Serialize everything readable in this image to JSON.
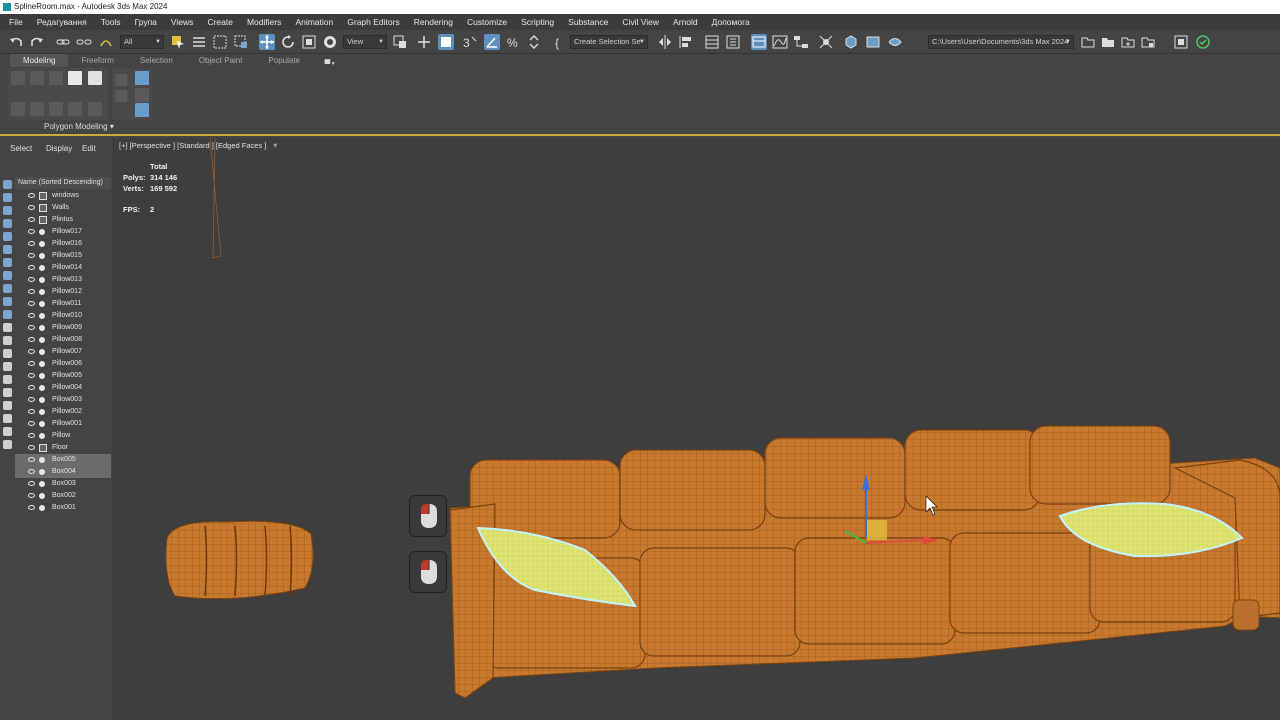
{
  "window": {
    "title": "SplineRoom.max - Autodesk 3ds Max 2024"
  },
  "menubar": {
    "items": [
      "File",
      "Редагування",
      "Tools",
      "Група",
      "Views",
      "Create",
      "Modifiers",
      "Animation",
      "Graph Editors",
      "Rendering",
      "Customize",
      "Scripting",
      "Substance",
      "Civil View",
      "Arnold",
      "Допомога"
    ]
  },
  "toolbar": {
    "selection_filter": "All",
    "reference_coord": "View",
    "named_selection_placeholder": "Create Selection Se",
    "project_path": "C:\\Users\\User\\Documents\\3ds Max 2024"
  },
  "ribbon": {
    "tabs": [
      "Modeling",
      "Freeform",
      "Selection",
      "Object Paint",
      "Populate"
    ],
    "active_tab": "Modeling",
    "panel_label": "Polygon Modeling"
  },
  "explorer": {
    "tabs": [
      "Select",
      "Display",
      "Edit"
    ],
    "column_header": "Name (Sorted Descending)",
    "items": [
      {
        "name": "windows",
        "type": "group",
        "selected": false
      },
      {
        "name": "Walls",
        "type": "group",
        "selected": false
      },
      {
        "name": "Plintus",
        "type": "group",
        "selected": false
      },
      {
        "name": "Pillow017",
        "type": "object",
        "selected": false
      },
      {
        "name": "Pillow016",
        "type": "object",
        "selected": false
      },
      {
        "name": "Pillow015",
        "type": "object",
        "selected": false
      },
      {
        "name": "Pillow014",
        "type": "object",
        "selected": false
      },
      {
        "name": "Pillow013",
        "type": "object",
        "selected": false
      },
      {
        "name": "Pillow012",
        "type": "object",
        "selected": false
      },
      {
        "name": "Pillow011",
        "type": "object",
        "selected": false
      },
      {
        "name": "Pillow010",
        "type": "object",
        "selected": false
      },
      {
        "name": "Pillow009",
        "type": "object",
        "selected": false
      },
      {
        "name": "Pillow008",
        "type": "object",
        "selected": false
      },
      {
        "name": "Pillow007",
        "type": "object",
        "selected": false
      },
      {
        "name": "Pillow006",
        "type": "object",
        "selected": false
      },
      {
        "name": "Pillow005",
        "type": "object",
        "selected": false
      },
      {
        "name": "Pillow004",
        "type": "object",
        "selected": false
      },
      {
        "name": "Pillow003",
        "type": "object",
        "selected": false
      },
      {
        "name": "Pillow002",
        "type": "object",
        "selected": false
      },
      {
        "name": "Pillow001",
        "type": "object",
        "selected": false
      },
      {
        "name": "Pillow",
        "type": "object",
        "selected": false
      },
      {
        "name": "Floor",
        "type": "group",
        "selected": false
      },
      {
        "name": "Box005",
        "type": "object",
        "selected": true
      },
      {
        "name": "Box004",
        "type": "object",
        "selected": true
      },
      {
        "name": "Box003",
        "type": "object",
        "selected": false
      },
      {
        "name": "Box002",
        "type": "object",
        "selected": false
      },
      {
        "name": "Box001",
        "type": "object",
        "selected": false
      }
    ]
  },
  "viewport": {
    "label": "[+] [Perspective ] [Standard ] [Edged Faces ]",
    "stats": {
      "header": "Total",
      "polys_label": "Polys:",
      "polys": "314 146",
      "verts_label": "Verts:",
      "verts": "169 592",
      "fps_label": "FPS:",
      "fps": "2"
    }
  },
  "colors": {
    "sofa": "#c8792e",
    "pillow": "#d9df66",
    "accent": "#5f8fbf",
    "ribbon_border": "#c9a846"
  }
}
